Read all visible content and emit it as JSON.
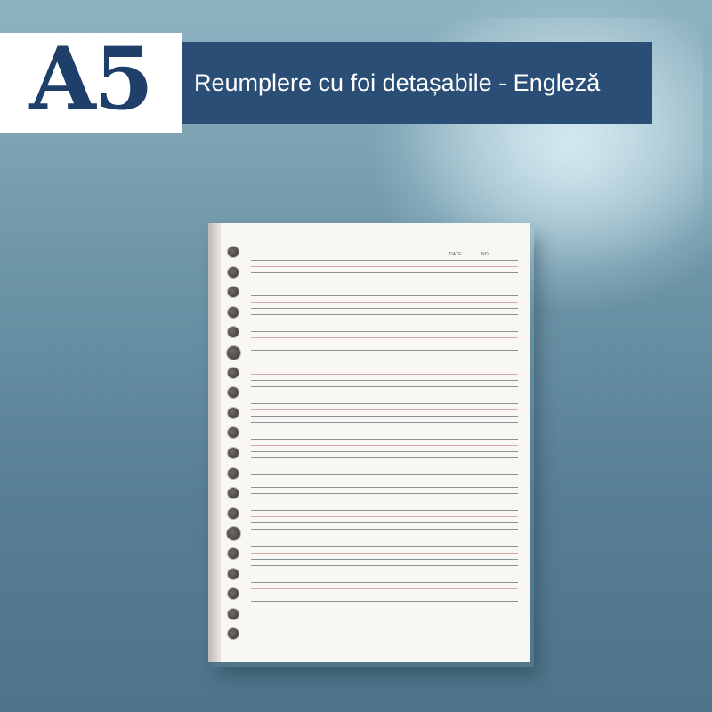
{
  "badge": {
    "text": "A5"
  },
  "banner": {
    "text": "Reumplere cu foi detașabile - Engleză"
  },
  "sheet": {
    "date_label": "DATE:",
    "no_label": "NO:",
    "colors": {
      "grey_line": "#8e9298",
      "red_line": "#d9a7a3",
      "paper": "#f8f7f3"
    },
    "ruled_groups": 10,
    "lines_per_group": 4,
    "holes": 20
  },
  "colors": {
    "brand_navy": "#1f3f6b",
    "banner_blue": "#2a4e75"
  }
}
